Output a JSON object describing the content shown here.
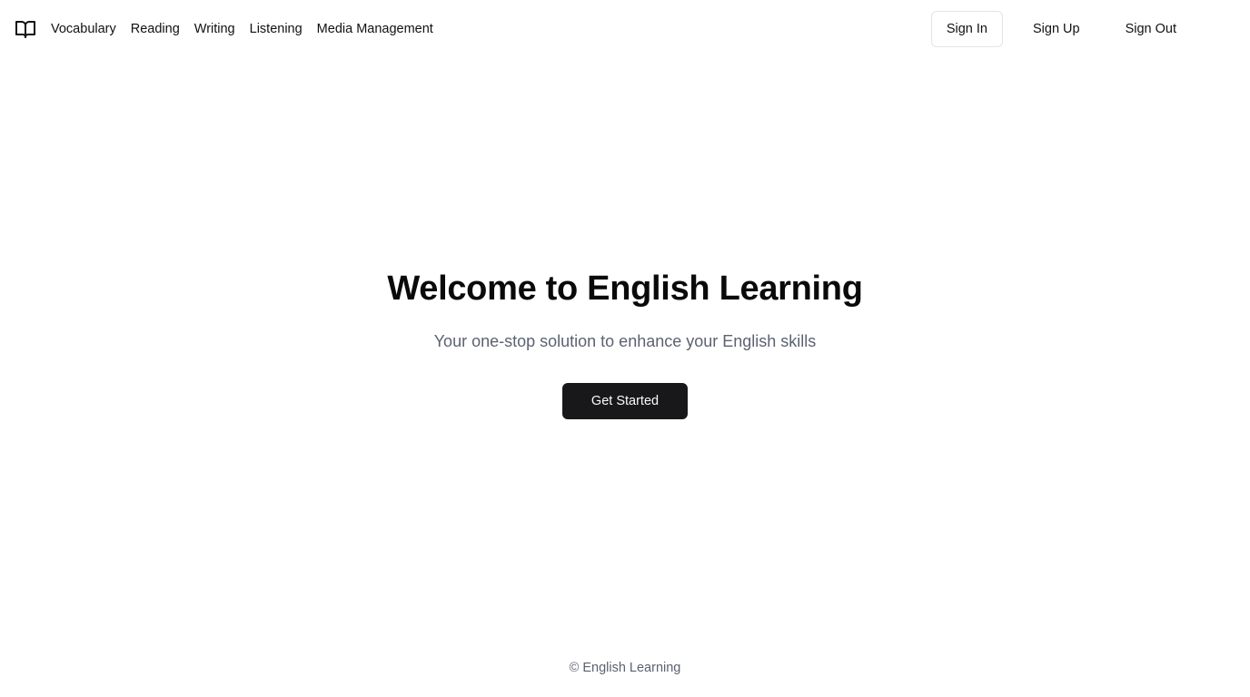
{
  "header": {
    "logo_icon": "book-open-icon",
    "nav": [
      {
        "label": "Vocabulary"
      },
      {
        "label": "Reading"
      },
      {
        "label": "Writing"
      },
      {
        "label": "Listening"
      },
      {
        "label": "Media Management"
      }
    ],
    "auth": {
      "sign_in": "Sign In",
      "sign_up": "Sign Up",
      "sign_out": "Sign Out"
    }
  },
  "hero": {
    "title": "Welcome to English Learning",
    "subtitle": "Your one-stop solution to enhance your English skills",
    "cta_label": "Get Started"
  },
  "footer": {
    "text": "© English Learning"
  },
  "colors": {
    "primary_button_bg": "#18181b",
    "primary_button_text": "#fafafa",
    "muted_text": "#5b6270",
    "border": "#e4e4e7"
  }
}
